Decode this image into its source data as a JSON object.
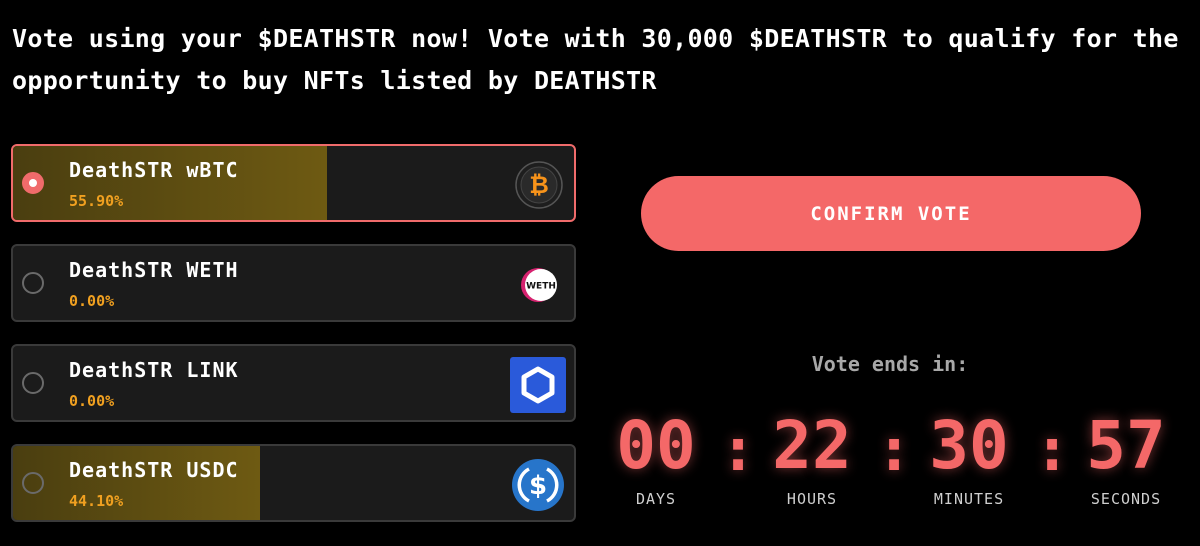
{
  "headline": "Vote using your $DEATHSTR now! Vote with 30,000 $DEATHSTR to qualify for the opportunity to buy NFTs listed by DEATHSTR",
  "options": [
    {
      "name": "DeathSTR wBTC",
      "percent_label": "55.90%",
      "fill_fraction": 0.559,
      "selected": true,
      "icon": "bitcoin-icon"
    },
    {
      "name": "DeathSTR WETH",
      "percent_label": "0.00%",
      "fill_fraction": 0.0,
      "selected": false,
      "icon": "weth-icon",
      "icon_text": "WETH"
    },
    {
      "name": "DeathSTR LINK",
      "percent_label": "0.00%",
      "fill_fraction": 0.0,
      "selected": false,
      "icon": "chainlink-icon"
    },
    {
      "name": "DeathSTR USDC",
      "percent_label": "44.10%",
      "fill_fraction": 0.441,
      "selected": false,
      "icon": "usdc-icon"
    }
  ],
  "confirm_label": "CONFIRM VOTE",
  "countdown": {
    "label": "Vote ends in:",
    "separator": ":",
    "days": "00",
    "days_label": "DAYS",
    "hours": "22",
    "hours_label": "HOURS",
    "minutes": "30",
    "minutes_label": "MINUTES",
    "seconds": "57",
    "seconds_label": "SECONDS"
  },
  "colors": {
    "accent": "#f46868",
    "percent": "#f0a020",
    "fill": "#6e5a12",
    "card_bg": "#1b1b1b",
    "chainlink_blue": "#2a5ada",
    "usdc_blue": "#2775ca",
    "bitcoin_orange": "#f7931a"
  }
}
